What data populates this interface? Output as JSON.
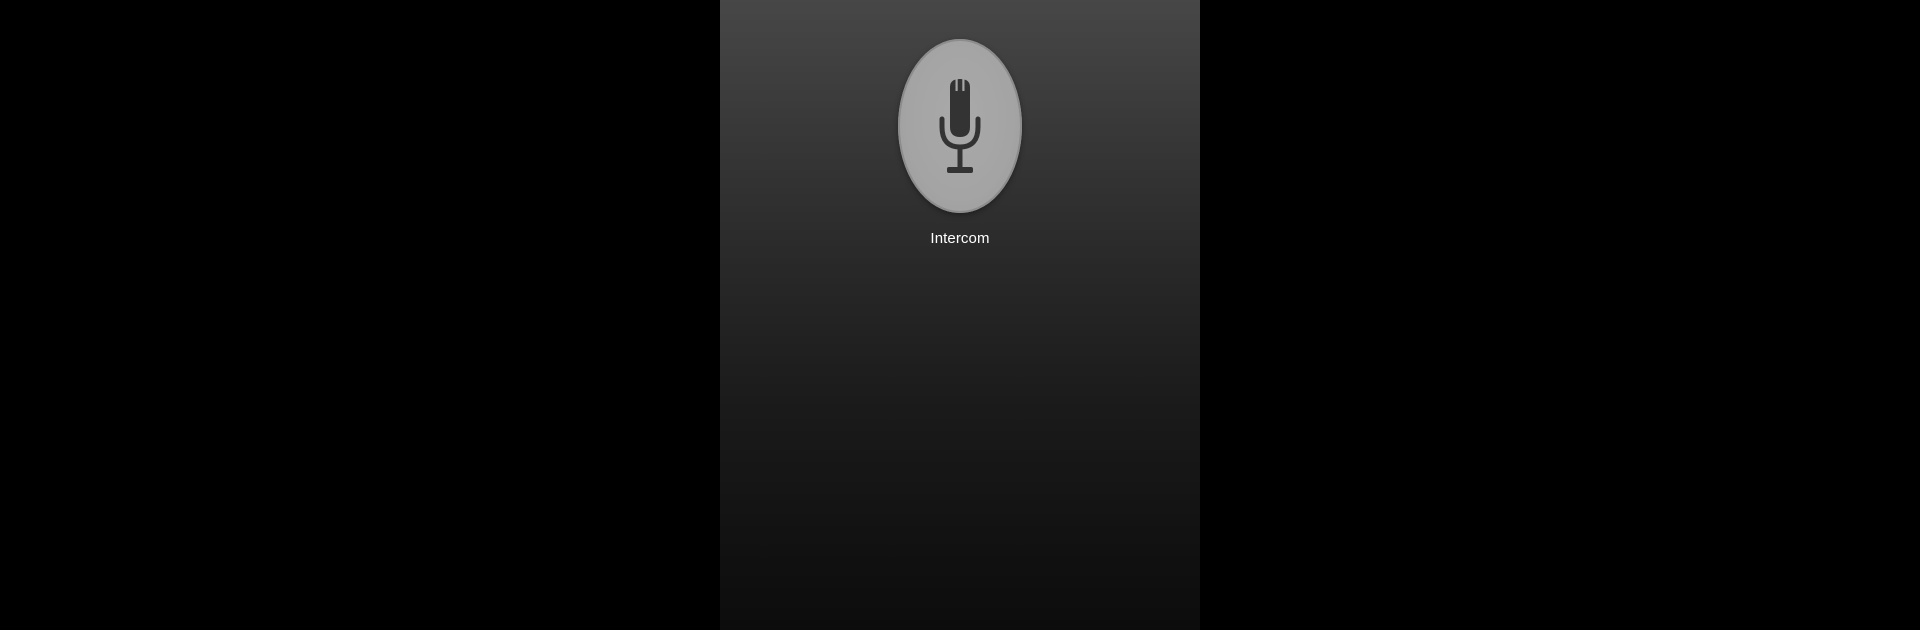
{
  "intercom": {
    "label": "Intercom",
    "icon": "microphone-icon"
  },
  "colors": {
    "outer_background": "#000000",
    "screen_gradient_top": "#474747",
    "screen_gradient_bottom": "#0c0c0c",
    "button_fill": "#a6a6a6",
    "icon_color": "#333333",
    "label_color": "#ffffff"
  }
}
